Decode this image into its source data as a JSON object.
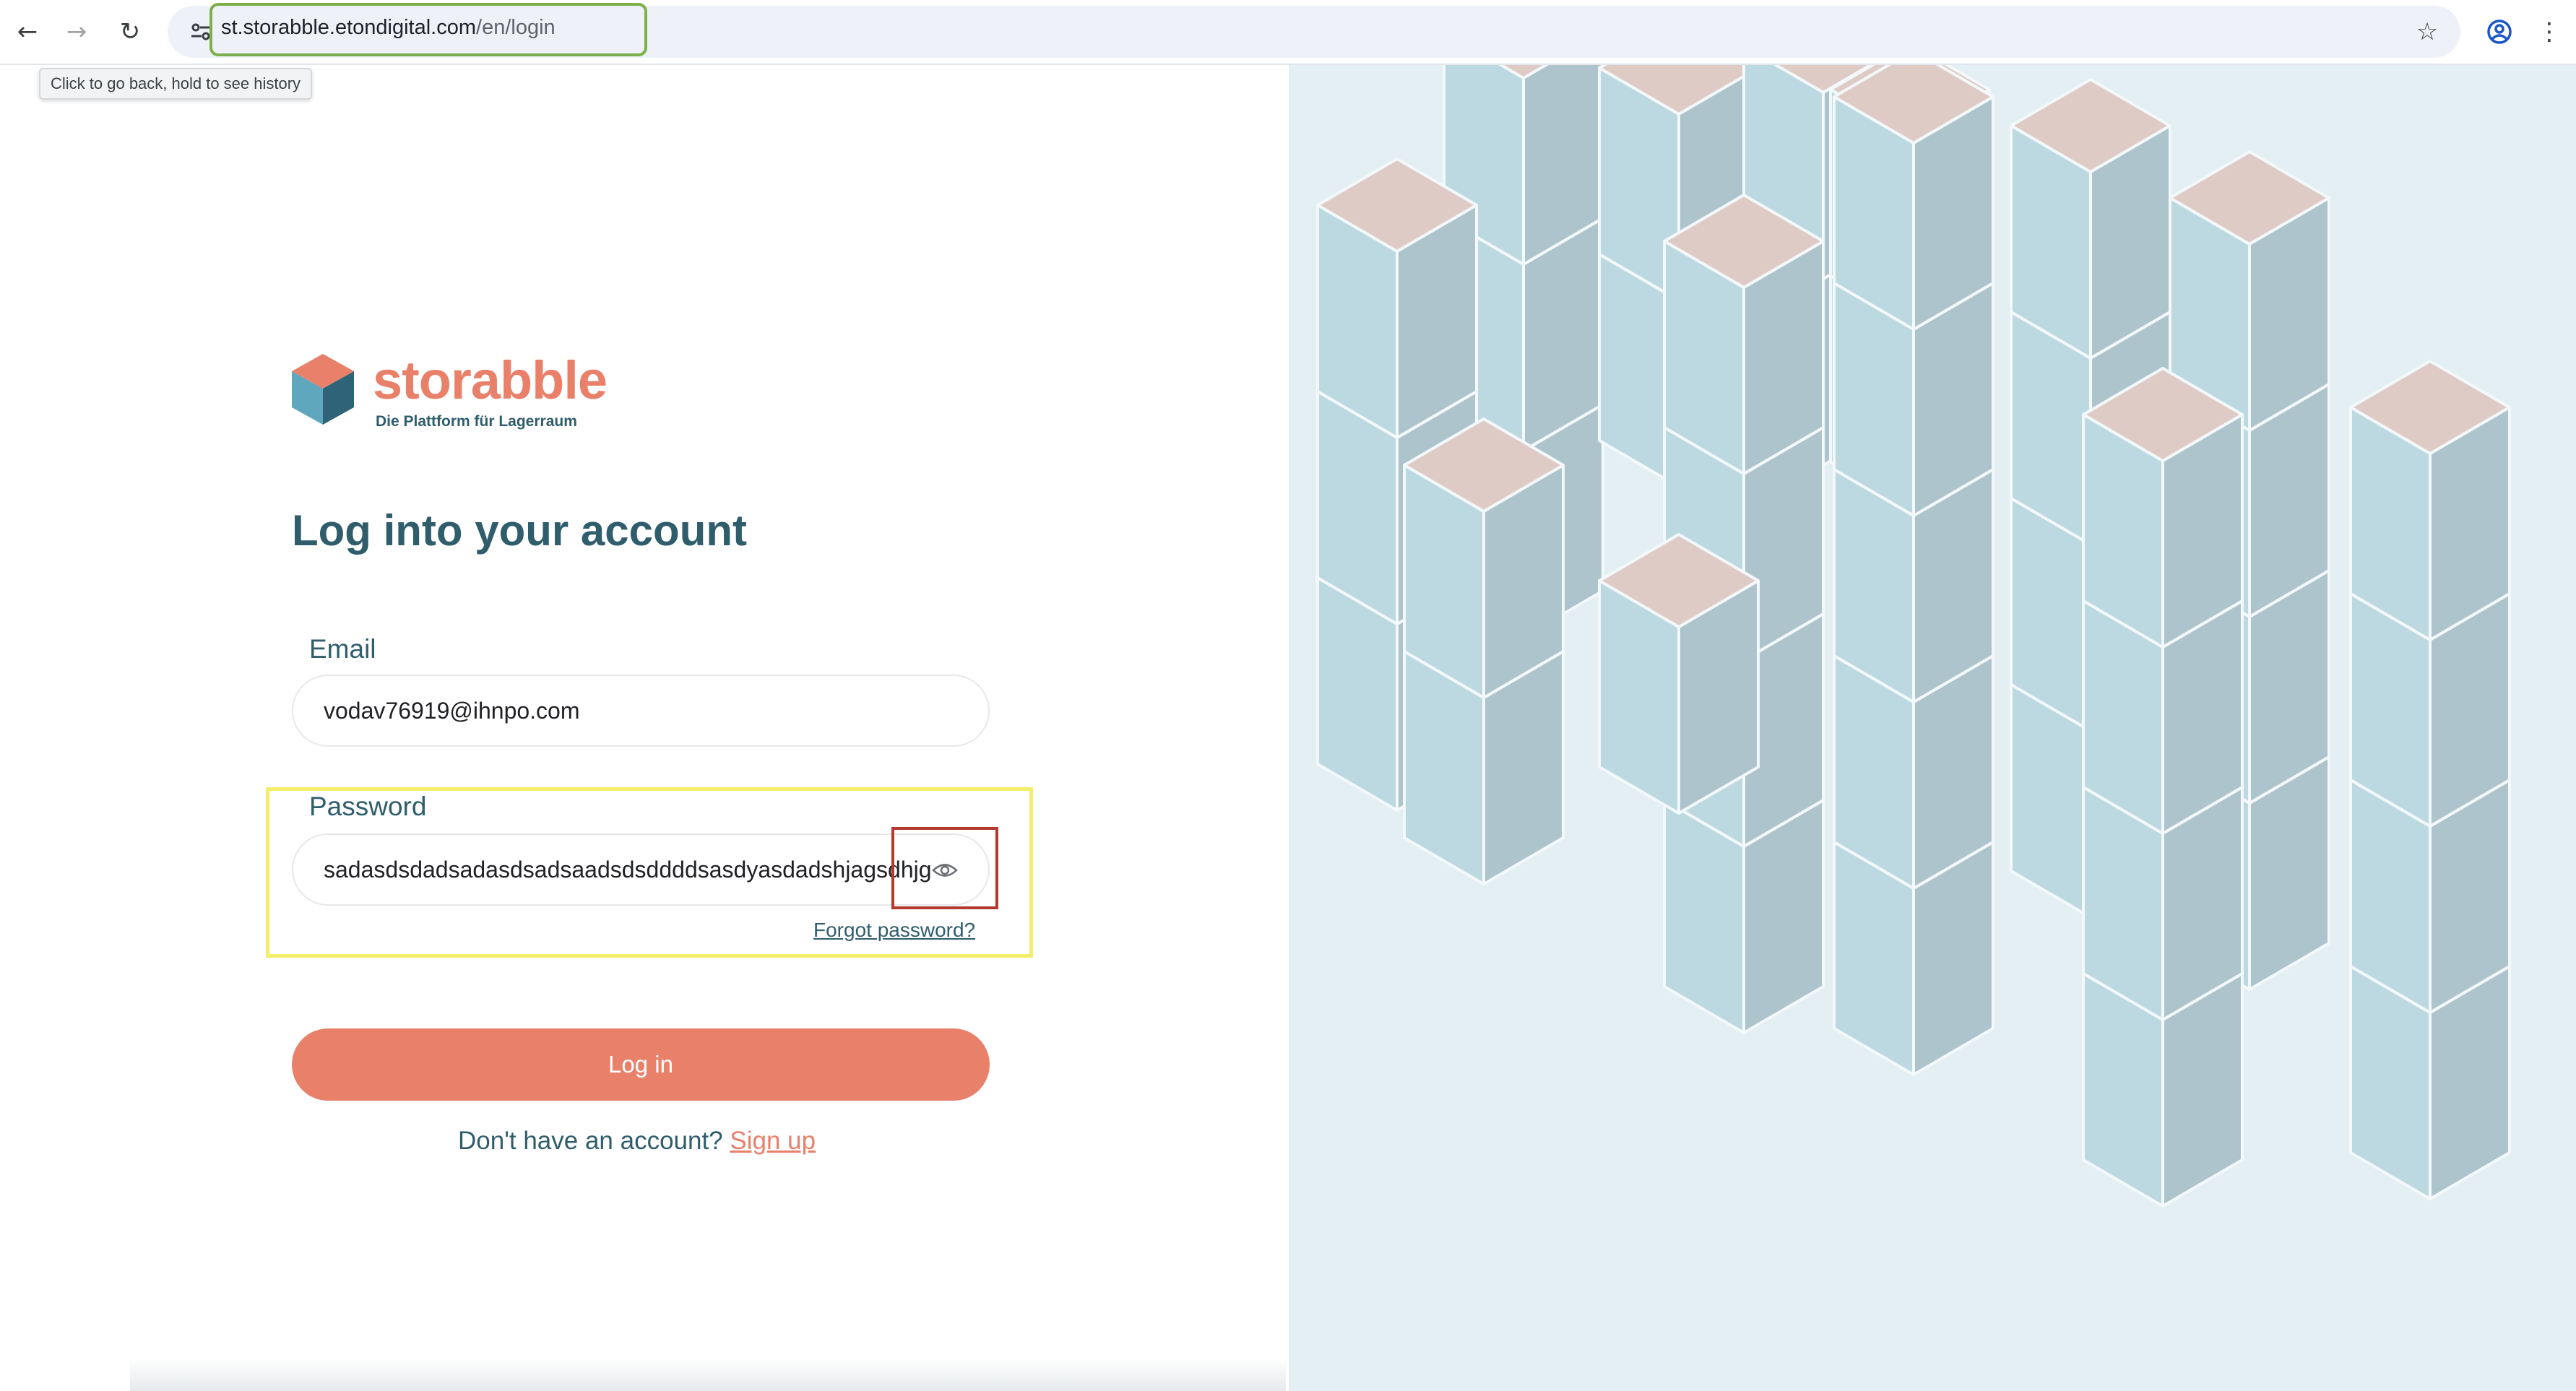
{
  "browser": {
    "url_host": "st.storabble.etondigital.com",
    "url_path": "/en/login",
    "tooltip": "Click to go back, hold to see history",
    "icons": {
      "back": "arrow-left-icon",
      "forward": "arrow-right-icon",
      "reload": "reload-icon",
      "site_info": "tune-icon",
      "bookmark": "star-icon",
      "profile": "account-circle-icon",
      "menu": "kebab-menu-icon"
    },
    "highlight_colors": {
      "url": "#7db04a",
      "password_group": "#f5ee6a",
      "eye_toggle": "#b23a30"
    }
  },
  "logo": {
    "name": "storabble",
    "tagline": "Die Plattform für Lagerraum"
  },
  "login": {
    "heading": "Log into your account",
    "email_label": "Email",
    "email_value": "vodav76919@ihnpo.com",
    "password_label": "Password",
    "password_value": "sadasdsdadsadasdsadsaadsdsddddsasdyasdadshjagsdhjg",
    "forgot_password": "Forgot password?",
    "login_button": "Log in",
    "signup_prompt": "Don't have an account?",
    "signup_link": "Sign up"
  },
  "colors": {
    "brand_orange": "#e8806a",
    "brand_teal": "#2f5d6c",
    "box_light": "#bcd9e2",
    "box_shade": "#aec4cc",
    "box_top": "#dfcbc6",
    "illustration_bg": "#e4eff3"
  }
}
